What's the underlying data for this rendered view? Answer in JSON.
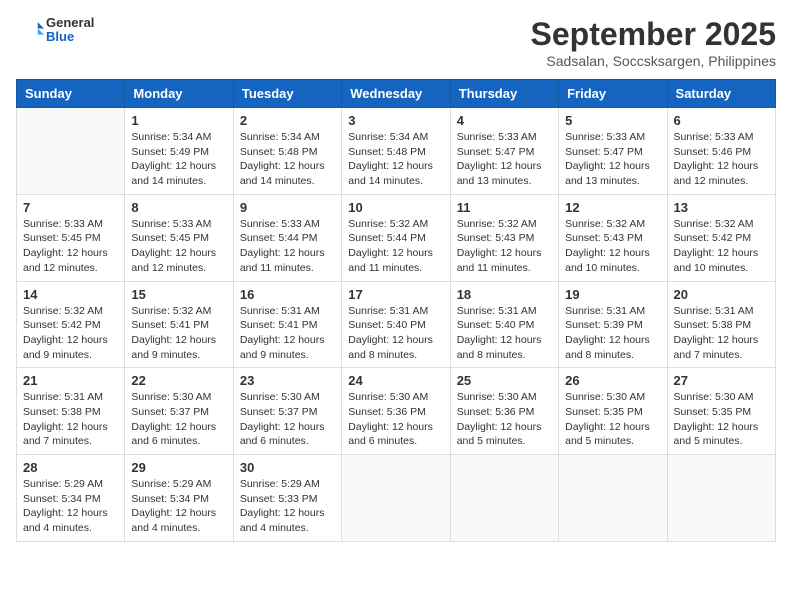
{
  "header": {
    "logo": {
      "general": "General",
      "blue": "Blue"
    },
    "title": "September 2025",
    "location": "Sadsalan, Soccsksargen, Philippines"
  },
  "days_of_week": [
    "Sunday",
    "Monday",
    "Tuesday",
    "Wednesday",
    "Thursday",
    "Friday",
    "Saturday"
  ],
  "weeks": [
    [
      {
        "day": "",
        "info": ""
      },
      {
        "day": "1",
        "info": "Sunrise: 5:34 AM\nSunset: 5:49 PM\nDaylight: 12 hours\nand 14 minutes."
      },
      {
        "day": "2",
        "info": "Sunrise: 5:34 AM\nSunset: 5:48 PM\nDaylight: 12 hours\nand 14 minutes."
      },
      {
        "day": "3",
        "info": "Sunrise: 5:34 AM\nSunset: 5:48 PM\nDaylight: 12 hours\nand 14 minutes."
      },
      {
        "day": "4",
        "info": "Sunrise: 5:33 AM\nSunset: 5:47 PM\nDaylight: 12 hours\nand 13 minutes."
      },
      {
        "day": "5",
        "info": "Sunrise: 5:33 AM\nSunset: 5:47 PM\nDaylight: 12 hours\nand 13 minutes."
      },
      {
        "day": "6",
        "info": "Sunrise: 5:33 AM\nSunset: 5:46 PM\nDaylight: 12 hours\nand 12 minutes."
      }
    ],
    [
      {
        "day": "7",
        "info": "Sunrise: 5:33 AM\nSunset: 5:45 PM\nDaylight: 12 hours\nand 12 minutes."
      },
      {
        "day": "8",
        "info": "Sunrise: 5:33 AM\nSunset: 5:45 PM\nDaylight: 12 hours\nand 12 minutes."
      },
      {
        "day": "9",
        "info": "Sunrise: 5:33 AM\nSunset: 5:44 PM\nDaylight: 12 hours\nand 11 minutes."
      },
      {
        "day": "10",
        "info": "Sunrise: 5:32 AM\nSunset: 5:44 PM\nDaylight: 12 hours\nand 11 minutes."
      },
      {
        "day": "11",
        "info": "Sunrise: 5:32 AM\nSunset: 5:43 PM\nDaylight: 12 hours\nand 11 minutes."
      },
      {
        "day": "12",
        "info": "Sunrise: 5:32 AM\nSunset: 5:43 PM\nDaylight: 12 hours\nand 10 minutes."
      },
      {
        "day": "13",
        "info": "Sunrise: 5:32 AM\nSunset: 5:42 PM\nDaylight: 12 hours\nand 10 minutes."
      }
    ],
    [
      {
        "day": "14",
        "info": "Sunrise: 5:32 AM\nSunset: 5:42 PM\nDaylight: 12 hours\nand 9 minutes."
      },
      {
        "day": "15",
        "info": "Sunrise: 5:32 AM\nSunset: 5:41 PM\nDaylight: 12 hours\nand 9 minutes."
      },
      {
        "day": "16",
        "info": "Sunrise: 5:31 AM\nSunset: 5:41 PM\nDaylight: 12 hours\nand 9 minutes."
      },
      {
        "day": "17",
        "info": "Sunrise: 5:31 AM\nSunset: 5:40 PM\nDaylight: 12 hours\nand 8 minutes."
      },
      {
        "day": "18",
        "info": "Sunrise: 5:31 AM\nSunset: 5:40 PM\nDaylight: 12 hours\nand 8 minutes."
      },
      {
        "day": "19",
        "info": "Sunrise: 5:31 AM\nSunset: 5:39 PM\nDaylight: 12 hours\nand 8 minutes."
      },
      {
        "day": "20",
        "info": "Sunrise: 5:31 AM\nSunset: 5:38 PM\nDaylight: 12 hours\nand 7 minutes."
      }
    ],
    [
      {
        "day": "21",
        "info": "Sunrise: 5:31 AM\nSunset: 5:38 PM\nDaylight: 12 hours\nand 7 minutes."
      },
      {
        "day": "22",
        "info": "Sunrise: 5:30 AM\nSunset: 5:37 PM\nDaylight: 12 hours\nand 6 minutes."
      },
      {
        "day": "23",
        "info": "Sunrise: 5:30 AM\nSunset: 5:37 PM\nDaylight: 12 hours\nand 6 minutes."
      },
      {
        "day": "24",
        "info": "Sunrise: 5:30 AM\nSunset: 5:36 PM\nDaylight: 12 hours\nand 6 minutes."
      },
      {
        "day": "25",
        "info": "Sunrise: 5:30 AM\nSunset: 5:36 PM\nDaylight: 12 hours\nand 5 minutes."
      },
      {
        "day": "26",
        "info": "Sunrise: 5:30 AM\nSunset: 5:35 PM\nDaylight: 12 hours\nand 5 minutes."
      },
      {
        "day": "27",
        "info": "Sunrise: 5:30 AM\nSunset: 5:35 PM\nDaylight: 12 hours\nand 5 minutes."
      }
    ],
    [
      {
        "day": "28",
        "info": "Sunrise: 5:29 AM\nSunset: 5:34 PM\nDaylight: 12 hours\nand 4 minutes."
      },
      {
        "day": "29",
        "info": "Sunrise: 5:29 AM\nSunset: 5:34 PM\nDaylight: 12 hours\nand 4 minutes."
      },
      {
        "day": "30",
        "info": "Sunrise: 5:29 AM\nSunset: 5:33 PM\nDaylight: 12 hours\nand 4 minutes."
      },
      {
        "day": "",
        "info": ""
      },
      {
        "day": "",
        "info": ""
      },
      {
        "day": "",
        "info": ""
      },
      {
        "day": "",
        "info": ""
      }
    ]
  ]
}
